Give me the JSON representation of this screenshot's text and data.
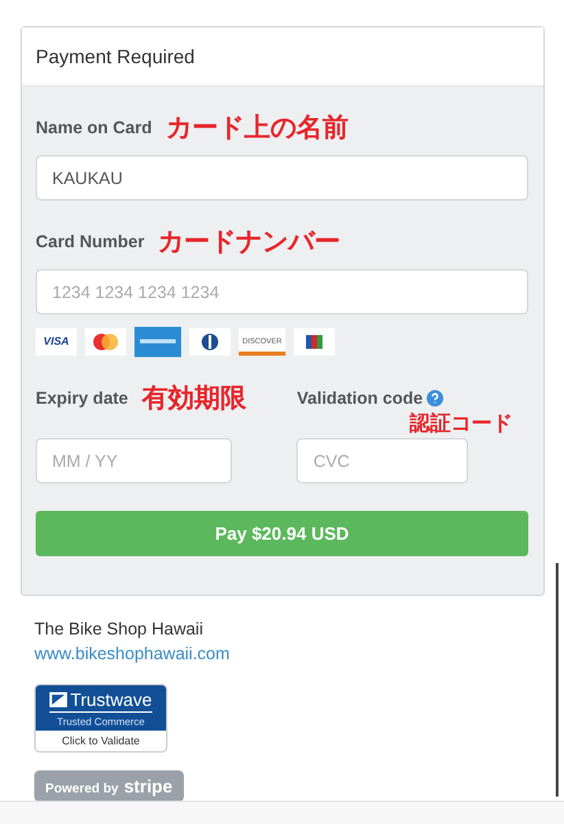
{
  "panel": {
    "title": "Payment Required"
  },
  "fields": [
    {
      "label": "Name on Card",
      "annotation": "カード上の名前",
      "value": "KAUKAU"
    },
    {
      "label": "Card Number",
      "annotation": "カードナンバー",
      "placeholder": "1234 1234 1234 1234"
    }
  ],
  "card_brands": [
    {
      "kind": "visa",
      "label": "VISA"
    },
    {
      "kind": "mastercard"
    },
    {
      "kind": "amex"
    },
    {
      "kind": "diners"
    },
    {
      "kind": "discover",
      "label": "DISCOVER"
    },
    {
      "kind": "jcb"
    }
  ],
  "expiry": {
    "label": "Expiry date",
    "annotation": "有効期限",
    "placeholder": "MM / YY"
  },
  "cvc": {
    "label": "Validation code",
    "annotation": "認証コード",
    "placeholder": "CVC"
  },
  "pay_button": "Pay $20.94 USD",
  "footer": {
    "shop": "The Bike Shop Hawaii",
    "link": "www.bikeshophawaii.com",
    "trust_badge": {
      "brand": "Trustwave",
      "subtitle": "Trusted Commerce",
      "action": "Click to Validate"
    },
    "powered_by": {
      "prefix": "Powered by",
      "brand": "stripe"
    }
  }
}
